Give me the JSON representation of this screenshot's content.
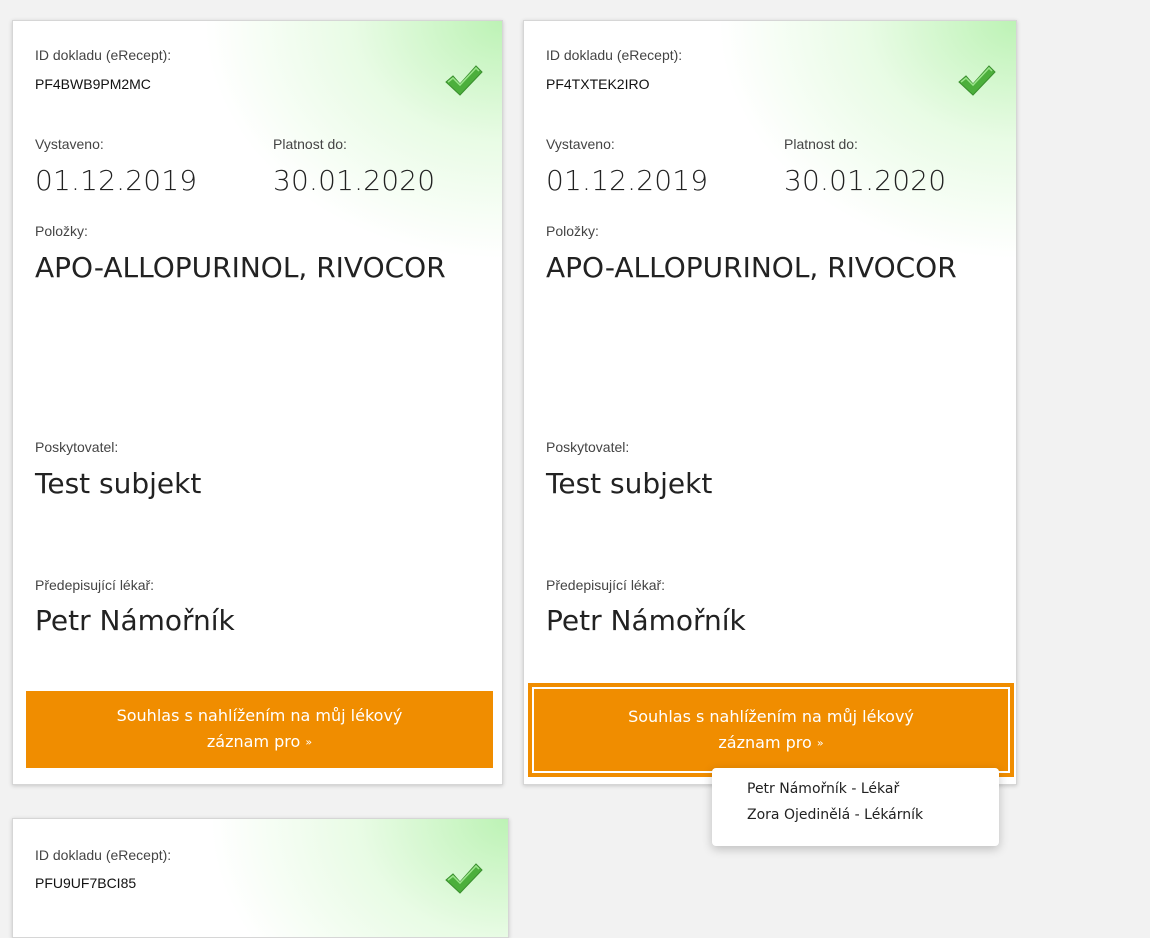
{
  "cards": [
    {
      "id_label": "ID dokladu (eRecept):",
      "id_value": "PF4BWB9PM2MC",
      "issued_label": "Vystaveno:",
      "issued_value": "01.12.2019",
      "valid_label": "Platnost do:",
      "valid_value": "30.01.2020",
      "items_label": "Položky:",
      "items_value": "APO-ALLOPURINOL, RIVOCOR",
      "provider_label": "Poskytovatel:",
      "provider_value": "Test subjekt",
      "doctor_label": "Předepisující lékař:",
      "doctor_value": "Petr Námořník",
      "consent_line1": "Souhlas s nahlížením na můj lékový",
      "consent_line2": "záznam pro",
      "caret": "»",
      "status_icon": "check-icon"
    },
    {
      "id_label": "ID dokladu (eRecept):",
      "id_value": "PF4TXTEK2IRO",
      "issued_label": "Vystaveno:",
      "issued_value": "01.12.2019",
      "valid_label": "Platnost do:",
      "valid_value": "30.01.2020",
      "items_label": "Položky:",
      "items_value": "APO-ALLOPURINOL, RIVOCOR",
      "provider_label": "Poskytovatel:",
      "provider_value": "Test subjekt",
      "doctor_label": "Předepisující lékař:",
      "doctor_value": "Petr Námořník",
      "consent_line1": "Souhlas s nahlížením na můj lékový",
      "consent_line2": "záznam pro",
      "caret": "»",
      "status_icon": "check-icon"
    },
    {
      "id_label": "ID dokladu (eRecept):",
      "id_value": "PFU9UF7BCI85",
      "status_icon": "check-icon"
    }
  ],
  "dropdown": {
    "items": [
      "Petr Námořník - Lékař",
      "Zora Ojedinělá - Lékárník"
    ]
  },
  "colors": {
    "accent": "#f08d00",
    "check": "#4caf3c",
    "background": "#f2f2f2"
  }
}
